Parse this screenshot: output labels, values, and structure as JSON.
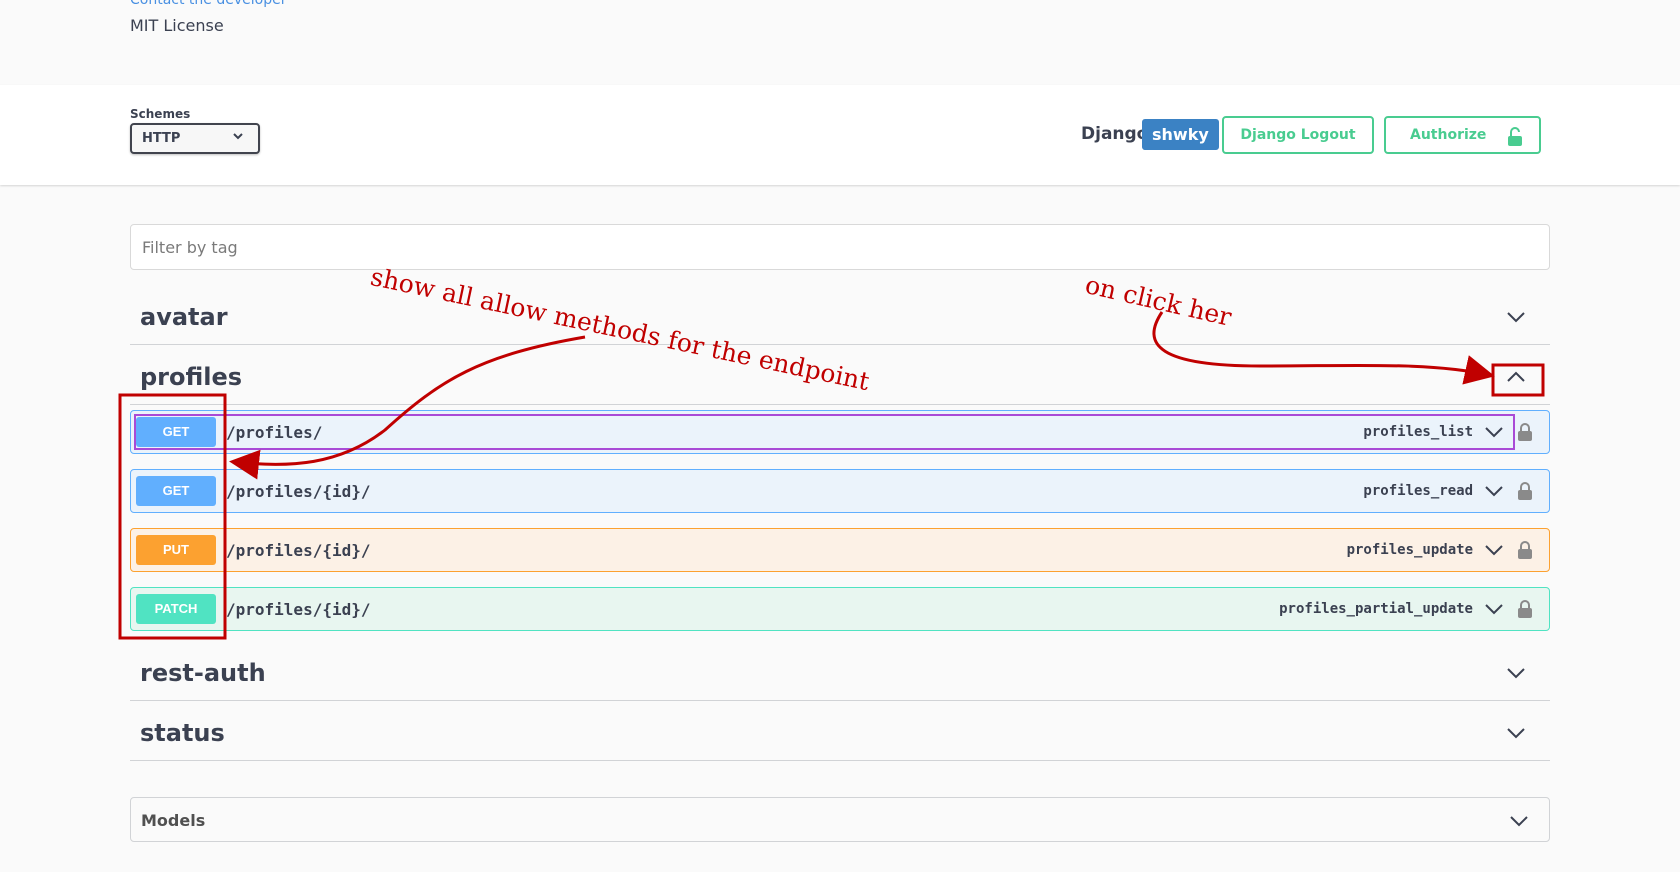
{
  "info": {
    "contact_link": "Contact the developer",
    "license": "MIT License"
  },
  "scheme_bar": {
    "schemes_label": "Schemes",
    "schemes_selected": "HTTP",
    "auth_provider": "Django",
    "username": "shwky",
    "logout_label": "Django Logout",
    "authorize_label": "Authorize"
  },
  "filter": {
    "placeholder": "Filter by tag"
  },
  "tags": [
    {
      "name": "avatar",
      "expanded": false
    },
    {
      "name": "profiles",
      "expanded": true
    },
    {
      "name": "rest-auth",
      "expanded": false
    },
    {
      "name": "status",
      "expanded": false
    }
  ],
  "operations": [
    {
      "method": "GET",
      "path": "/profiles/",
      "operation_id": "profiles_list"
    },
    {
      "method": "GET",
      "path": "/profiles/{id}/",
      "operation_id": "profiles_read"
    },
    {
      "method": "PUT",
      "path": "/profiles/{id}/",
      "operation_id": "profiles_update"
    },
    {
      "method": "PATCH",
      "path": "/profiles/{id}/",
      "operation_id": "profiles_partial_update"
    }
  ],
  "models": {
    "title": "Models"
  },
  "annotations": {
    "methods_note": "show all allow methods for the endpoint",
    "click_note": "on click her"
  },
  "colors": {
    "get": "#61affe",
    "put": "#fca130",
    "patch": "#50e3c2",
    "authorize": "#49cc90",
    "annotation": "#c00000"
  }
}
